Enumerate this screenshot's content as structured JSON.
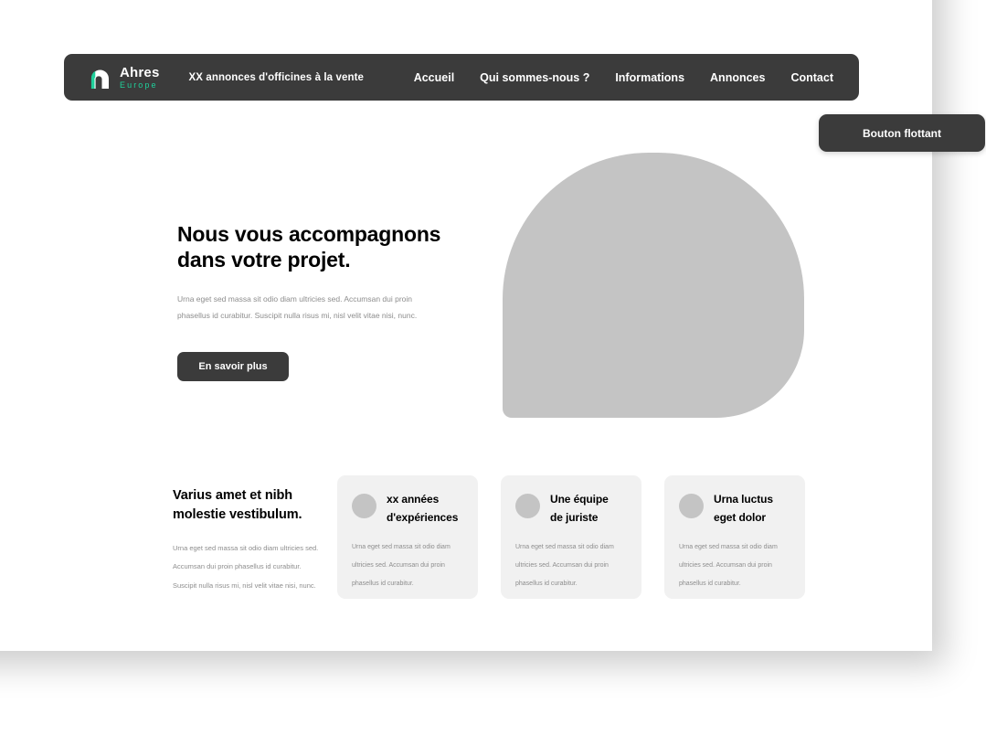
{
  "colors": {
    "dark": "#3b3b3b",
    "accent_teal": "#1fd09b",
    "placeholder_gray": "#c4c4c4",
    "card_gray": "#f1f1f1",
    "muted_text": "#8d8d8d",
    "page_background": "#ffffff"
  },
  "header": {
    "brand_name": "Ahres",
    "brand_sub": "Europe",
    "logo_icon": "ahres-arch-logo-icon",
    "tagline": "XX annonces d'officines à la vente",
    "nav": [
      {
        "label": "Accueil"
      },
      {
        "label": "Qui sommes-nous ?"
      },
      {
        "label": "Informations"
      },
      {
        "label": "Annonces"
      },
      {
        "label": "Contact"
      }
    ]
  },
  "floating_button": {
    "label": "Bouton flottant"
  },
  "hero": {
    "title_line1": "Nous vous accompagnons",
    "title_line2": "dans votre projet.",
    "paragraph": "Urna eget sed massa sit odio diam ultricies sed. Accumsan dui proin phasellus id curabitur. Suscipit nulla risus mi, nisl velit vitae nisi, nunc.",
    "cta_label": "En savoir plus",
    "image_placeholder": "hero-arch-image-placeholder"
  },
  "features": {
    "title_line1": "Varius amet et nibh",
    "title_line2": "molestie vestibulum.",
    "paragraph_line1": "Urna eget sed massa sit odio diam ultricies sed.",
    "paragraph_line2": "Accumsan dui proin phasellus id curabitur.",
    "paragraph_line3": "Suscipit nulla risus mi, nisl velit vitae nisi, nunc.",
    "cards": [
      {
        "title_line1": "xx années",
        "title_line2": "d'expériences",
        "body_line1": "Urna eget sed massa sit odio diam",
        "body_line2": "ultricies sed. Accumsan dui proin",
        "body_line3": "phasellus id curabitur.",
        "icon": "circle-placeholder-icon"
      },
      {
        "title_line1": "Une équipe",
        "title_line2": "de juriste",
        "body_line1": "Urna eget sed massa sit odio diam",
        "body_line2": "ultricies sed. Accumsan dui proin",
        "body_line3": "phasellus id curabitur.",
        "icon": "circle-placeholder-icon"
      },
      {
        "title_line1": "Urna luctus",
        "title_line2": "eget dolor",
        "body_line1": "Urna eget sed massa sit odio diam",
        "body_line2": "ultricies sed. Accumsan dui proin",
        "body_line3": "phasellus id curabitur.",
        "icon": "circle-placeholder-icon"
      }
    ]
  }
}
